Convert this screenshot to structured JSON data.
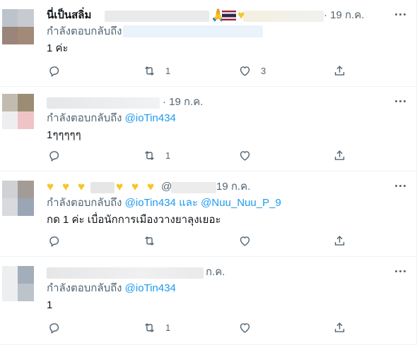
{
  "tweets": [
    {
      "name": "นี่เป็นสลิ่ม",
      "time": "· 19 ก.ค.",
      "replying_prefix": "กำลังตอบกลับถึง",
      "mentions": [],
      "content": "1 ค่ะ",
      "reply_count": "",
      "retweet_count": "1",
      "like_count": "3"
    },
    {
      "name": "",
      "time": "· 19 ก.ค.",
      "replying_prefix": "กำลังตอบกลับถึง",
      "mentions": [
        "@ioTin434"
      ],
      "content": "1ๆๆๆๆๆ",
      "reply_count": "",
      "retweet_count": "1",
      "like_count": ""
    },
    {
      "name": "💛💛💛 💛💛💛",
      "handle_fragment": "@",
      "time": "19 ก.ค.",
      "replying_prefix": "กำลังตอบกลับถึง",
      "mentions": [
        "@ioTin434",
        "@Nuu_Nuu_P_9"
      ],
      "mention_joiner": "และ",
      "content": "กด 1 ค่ะ เบื่อนักการเมืองวางยาลุงเยอะ",
      "reply_count": "",
      "retweet_count": "",
      "like_count": ""
    },
    {
      "name": "",
      "time": "ก.ค.",
      "replying_prefix": "กำลังตอบกลับถึง",
      "mentions": [
        "@ioTin434"
      ],
      "content": "1",
      "reply_count": "",
      "retweet_count": "1",
      "like_count": ""
    }
  ],
  "colors": {
    "text": "#0f1419",
    "muted": "#536471",
    "link": "#1d9bf0",
    "divider": "#eff3f4"
  }
}
